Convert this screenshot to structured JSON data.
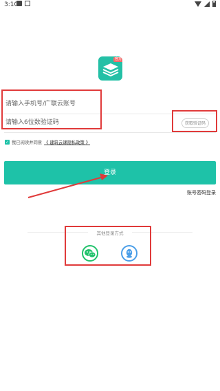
{
  "status_bar": {
    "time": "3:10"
  },
  "logo": {
    "badge": "官方"
  },
  "phone_input": {
    "placeholder": "请输入手机号/广联云账号"
  },
  "code_input": {
    "placeholder": "请输入6位数验证码"
  },
  "get_code_button": {
    "label": "获取验证码"
  },
  "agreement": {
    "text": "我已阅读并同意",
    "policy": "《 建筑云课隐私政策 》"
  },
  "login_button": {
    "label": "登录"
  },
  "password_login": {
    "label": "账号密码登录"
  },
  "other_login": {
    "title": "其他登录方式"
  },
  "colors": {
    "accent": "#1ec2a8",
    "wechat": "#21c26b",
    "qq": "#4a9ee8",
    "annotation": "#e03a3a"
  },
  "icons": [
    "wechat-icon",
    "qq-icon"
  ]
}
